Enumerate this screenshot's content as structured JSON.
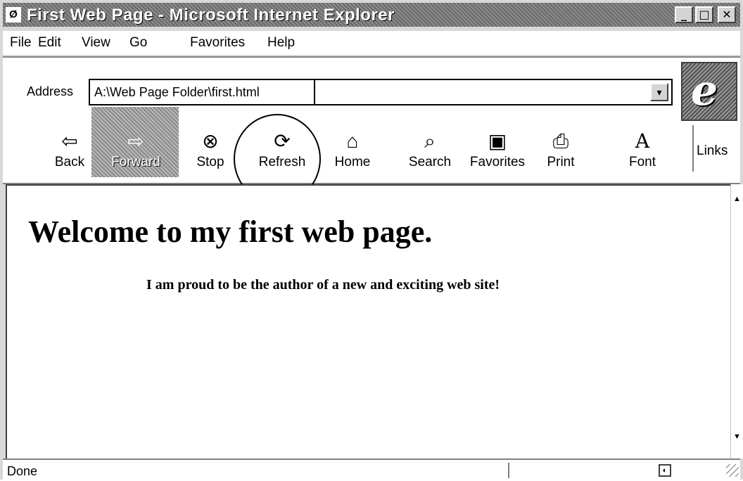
{
  "window": {
    "title": "First Web Page - Microsoft Internet Explorer",
    "controls": {
      "minimize": "_",
      "maximize": "□",
      "close": "✕"
    }
  },
  "menu": {
    "items": [
      {
        "label": "File"
      },
      {
        "label": "Edit"
      },
      {
        "label": "View"
      },
      {
        "label": "Go"
      },
      {
        "label": "Favorites"
      },
      {
        "label": "Help"
      }
    ]
  },
  "address": {
    "label": "Address",
    "value": "A:\\Web Page Folder\\first.html",
    "dropdown_icon": "▾"
  },
  "toolbar": {
    "buttons": [
      {
        "label": "Back",
        "icon": "back-arrow-icon",
        "glyph": "⇦"
      },
      {
        "label": "Forward",
        "icon": "forward-arrow-icon",
        "glyph": "⇨"
      },
      {
        "label": "Stop",
        "icon": "stop-icon",
        "glyph": "⊗"
      },
      {
        "label": "Refresh",
        "icon": "refresh-icon",
        "glyph": "⟳"
      },
      {
        "label": "Home",
        "icon": "home-icon",
        "glyph": "⌂"
      },
      {
        "label": "Search",
        "icon": "search-icon",
        "glyph": "⌕"
      },
      {
        "label": "Favorites",
        "icon": "favorites-icon",
        "glyph": "▣"
      },
      {
        "label": "Print",
        "icon": "print-icon",
        "glyph": "⎙"
      },
      {
        "label": "Font",
        "icon": "font-icon",
        "glyph": "A"
      }
    ],
    "links_label": "Links",
    "throbber_logo": "e"
  },
  "page": {
    "heading": "Welcome to my first web page.",
    "paragraph": "I am proud to be the author of a new and exciting web site!"
  },
  "status": {
    "text": "Done"
  },
  "scrollbar": {
    "up": "▲",
    "down": "▼"
  }
}
